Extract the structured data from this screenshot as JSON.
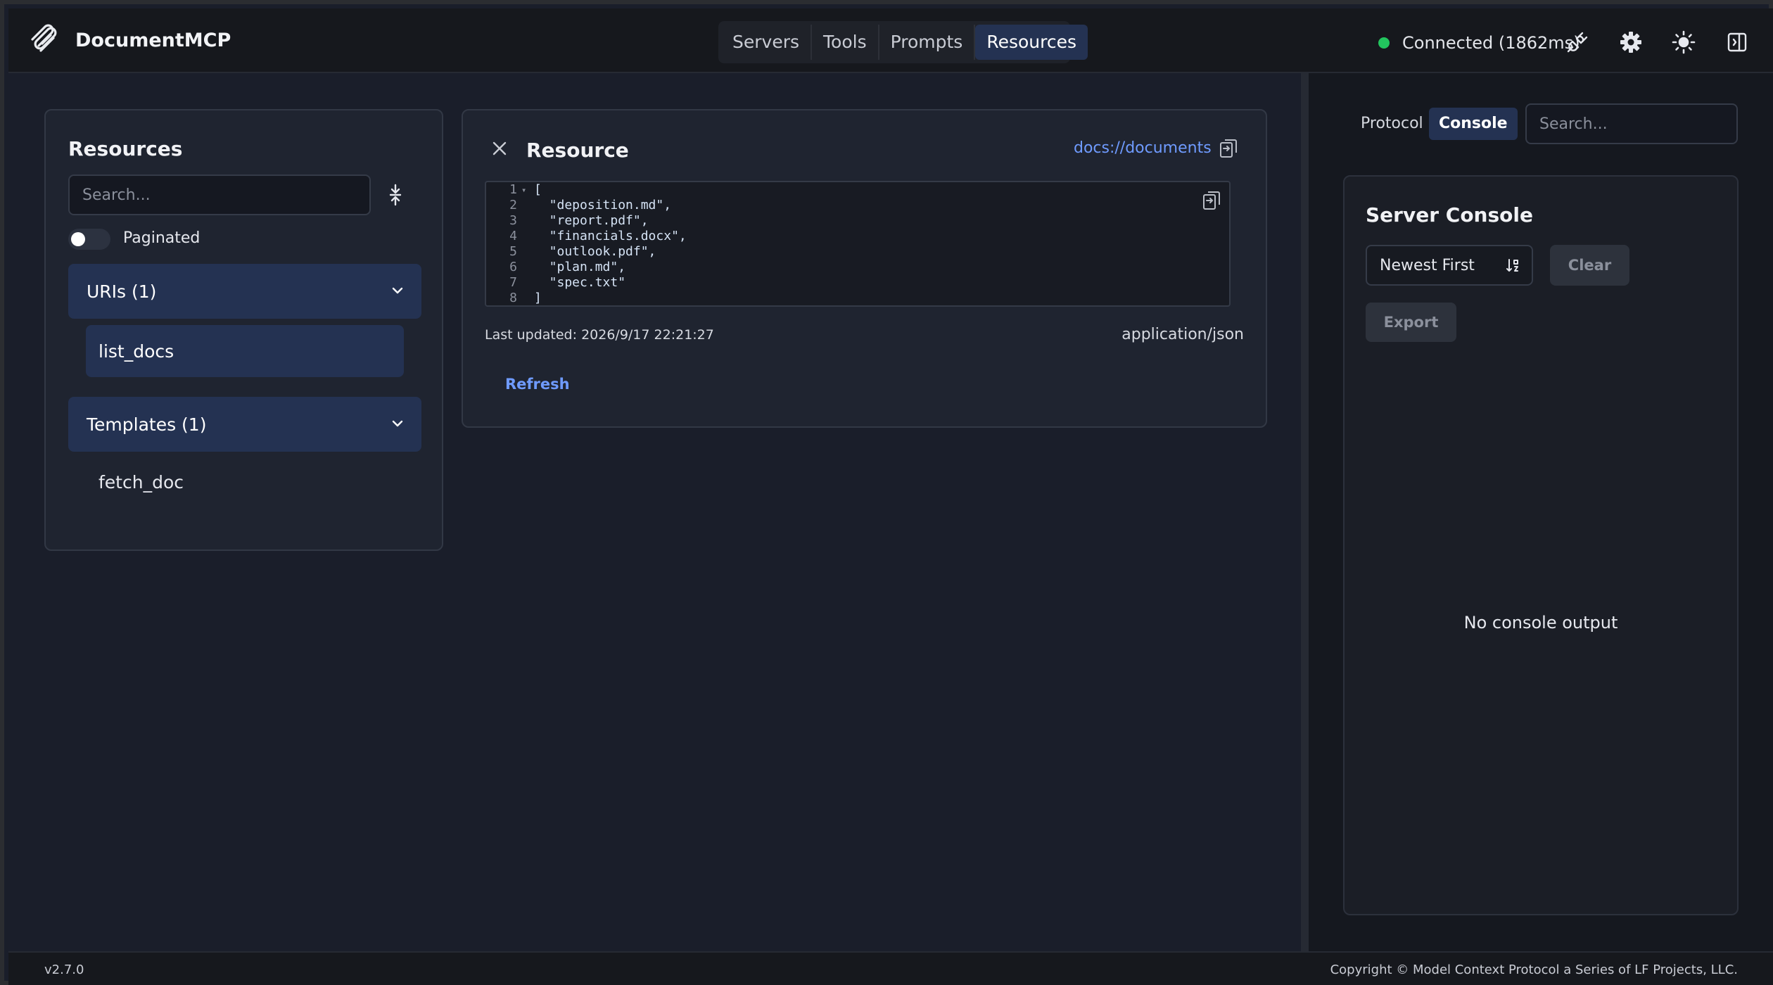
{
  "app": {
    "name": "DocumentMCP"
  },
  "nav": {
    "tabs": [
      "Servers",
      "Tools",
      "Prompts",
      "Resources"
    ],
    "active": "Resources"
  },
  "status": {
    "text": "Connected (1862ms)",
    "color": "#22c55e"
  },
  "header_icons": [
    "plug-icon",
    "gear-icon",
    "sun-icon",
    "sidebar-toggle-icon"
  ],
  "resources_panel": {
    "title": "Resources",
    "search_placeholder": "Search...",
    "paginated_label": "Paginated",
    "uris_label": "URIs (1)",
    "uri_items": [
      "list_docs"
    ],
    "templates_label": "Templates (1)",
    "template_items": [
      "fetch_doc"
    ]
  },
  "resource_view": {
    "title": "Resource",
    "uri": "docs://documents",
    "code_lines": [
      "[",
      "  \"deposition.md\",",
      "  \"report.pdf\",",
      "  \"financials.docx\",",
      "  \"outlook.pdf\",",
      "  \"plan.md\",",
      "  \"spec.txt\"",
      "]"
    ],
    "line_numbers": [
      "1",
      "2",
      "3",
      "4",
      "5",
      "6",
      "7",
      "8"
    ],
    "last_updated": "Last updated: 2026/9/17 22:21:27",
    "mime_type": "application/json",
    "refresh_label": "Refresh"
  },
  "console": {
    "tabs": [
      "Protocol",
      "Console"
    ],
    "active_tab": "Console",
    "search_placeholder": "Search...",
    "title": "Server Console",
    "sort_value": "Newest First",
    "clear_label": "Clear",
    "export_label": "Export",
    "empty_text": "No console output"
  },
  "footer": {
    "version": "v2.7.0",
    "copyright": "Copyright © Model Context Protocol a Series of LF Projects, LLC."
  },
  "colors": {
    "accent": "#6f9bff",
    "active_bg": "#243252"
  }
}
